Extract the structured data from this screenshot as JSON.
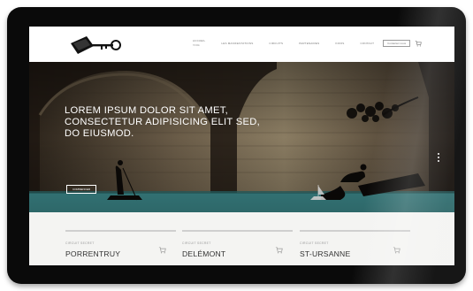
{
  "header": {
    "nav_items": [
      {
        "label": "Accueil",
        "sub": "Home"
      },
      {
        "label": "Les Manifestations"
      },
      {
        "label": "Circuits"
      },
      {
        "label": "Partenaires"
      },
      {
        "label": "Infos"
      },
      {
        "label": "Contact"
      }
    ],
    "contact_button": "Contactez-nous"
  },
  "hero": {
    "title_lines": [
      "LOREM IPSUM DOLOR SIT AMET,",
      "CONSECTETUR ADIPISICING ELIT SED,",
      "DO EIUSMOD."
    ],
    "button_label": "Commencer"
  },
  "circuits": [
    {
      "label": "Circuit secret",
      "city": "PORRENTRUY"
    },
    {
      "label": "Circuit secret",
      "city": "DELÉMONT"
    },
    {
      "label": "Circuit secret",
      "city": "ST-URSANNE"
    }
  ],
  "colors": {
    "bezel": "#0a0a0a",
    "water": "#3d8a8c",
    "page_bg": "#f4f4f2"
  }
}
